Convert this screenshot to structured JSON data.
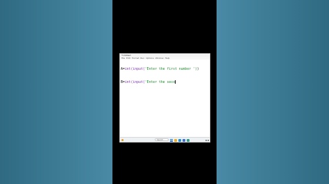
{
  "window": {
    "title": "*Untitled"
  },
  "menu": [
    "File",
    "Edit",
    "Format",
    "Run",
    "Options",
    "Window",
    "Help"
  ],
  "code": {
    "line1": {
      "var": "A",
      "op": "=",
      "fn": "int(input(",
      "str": "'Enter the first number ')",
      "rest": ")"
    },
    "line2": {
      "var": "B",
      "op": "=",
      "fn": "int(input(",
      "str": "'Enter the seco",
      "rest": ""
    }
  },
  "taskbar": {
    "search_placeholder": "Search"
  },
  "colors": {
    "keyword_fn": "#7a2fb8",
    "string": "#1e8a2e",
    "desktop": "#3f7f98"
  }
}
